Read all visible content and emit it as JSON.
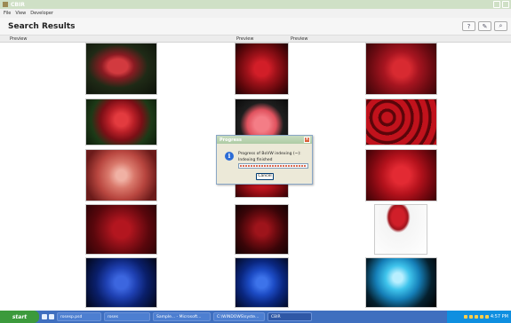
{
  "window": {
    "title": "CBIR",
    "buttons": [
      "_",
      "□",
      "x"
    ]
  },
  "menu": [
    "File",
    "View",
    "Developer"
  ],
  "header": {
    "title": "Search Results",
    "tools": [
      "?",
      "✎",
      "⌕"
    ]
  },
  "columns": [
    "Preview",
    "Preview",
    "Preview"
  ],
  "grid": [
    {
      "id": "rose-1",
      "desc": "red rose on green stem"
    },
    {
      "id": "rose-2",
      "desc": "red rose with leaves"
    },
    {
      "id": "rose-3",
      "desc": "large red rose"
    },
    {
      "id": "rose-4",
      "desc": "red rose on white background"
    },
    {
      "id": "rose-5",
      "desc": "pink rose"
    },
    {
      "id": "rose-6",
      "desc": "many red roses"
    },
    {
      "id": "rose-7",
      "desc": "salmon rose with dew"
    },
    {
      "id": "rose-8",
      "desc": "red rose closeup"
    },
    {
      "id": "rose-9",
      "desc": "red rose closeup"
    },
    {
      "id": "rose-10",
      "desc": "dark red rose"
    },
    {
      "id": "rose-11",
      "desc": "dark red rose"
    },
    {
      "id": "rose-12",
      "desc": "red rose with stem"
    },
    {
      "id": "rose-13",
      "desc": "blue rose"
    },
    {
      "id": "rose-14",
      "desc": "blue rose"
    },
    {
      "id": "rose-15",
      "desc": "light blue rose"
    }
  ],
  "dialog": {
    "title": "Progress",
    "line1": "Progress of BoVW indexing (~):",
    "line2": "Indexing finished",
    "progress": 1.0,
    "cancel": "Cancel"
  },
  "taskbar": {
    "start": "start",
    "items": [
      "rosesp.psd",
      "roses",
      "Sample... - Microsoft...",
      "C:\\WINDOWS\\syste...",
      "CBIR"
    ],
    "clock": "4:57 PM"
  }
}
